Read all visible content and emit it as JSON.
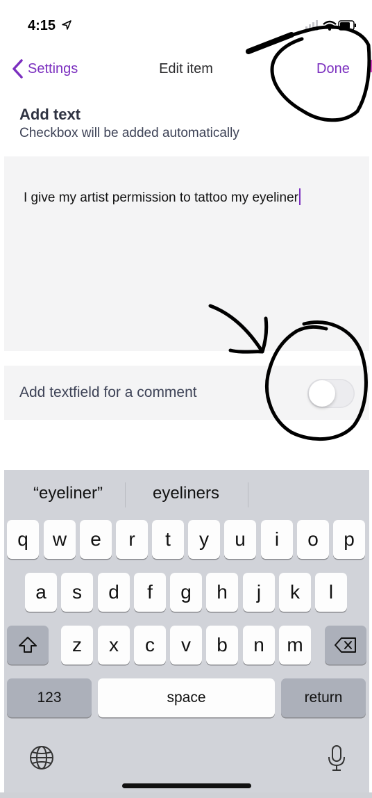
{
  "status_bar": {
    "time": "4:15"
  },
  "nav": {
    "back_label": "Settings",
    "title": "Edit item",
    "done_label": "Done"
  },
  "section": {
    "title": "Add text",
    "subtitle": "Checkbox will be added automatically"
  },
  "editor": {
    "value": "I give my artist permission to tattoo my eyeliner"
  },
  "comment_toggle": {
    "label": "Add textfield for a comment",
    "on": false
  },
  "keyboard": {
    "suggestions": [
      "“eyeliner”",
      "eyeliners"
    ],
    "row1": [
      "q",
      "w",
      "e",
      "r",
      "t",
      "y",
      "u",
      "i",
      "o",
      "p"
    ],
    "row2": [
      "a",
      "s",
      "d",
      "f",
      "g",
      "h",
      "j",
      "k",
      "l"
    ],
    "row3": [
      "z",
      "x",
      "c",
      "v",
      "b",
      "n",
      "m"
    ],
    "numbers_label": "123",
    "space_label": "space",
    "return_label": "return"
  },
  "colors": {
    "accent": "#7b2fbf",
    "annotation": "#000000"
  },
  "icons": [
    "location-arrow-icon",
    "chevron-left-icon",
    "shift-icon",
    "backspace-icon",
    "globe-icon",
    "microphone-icon"
  ]
}
